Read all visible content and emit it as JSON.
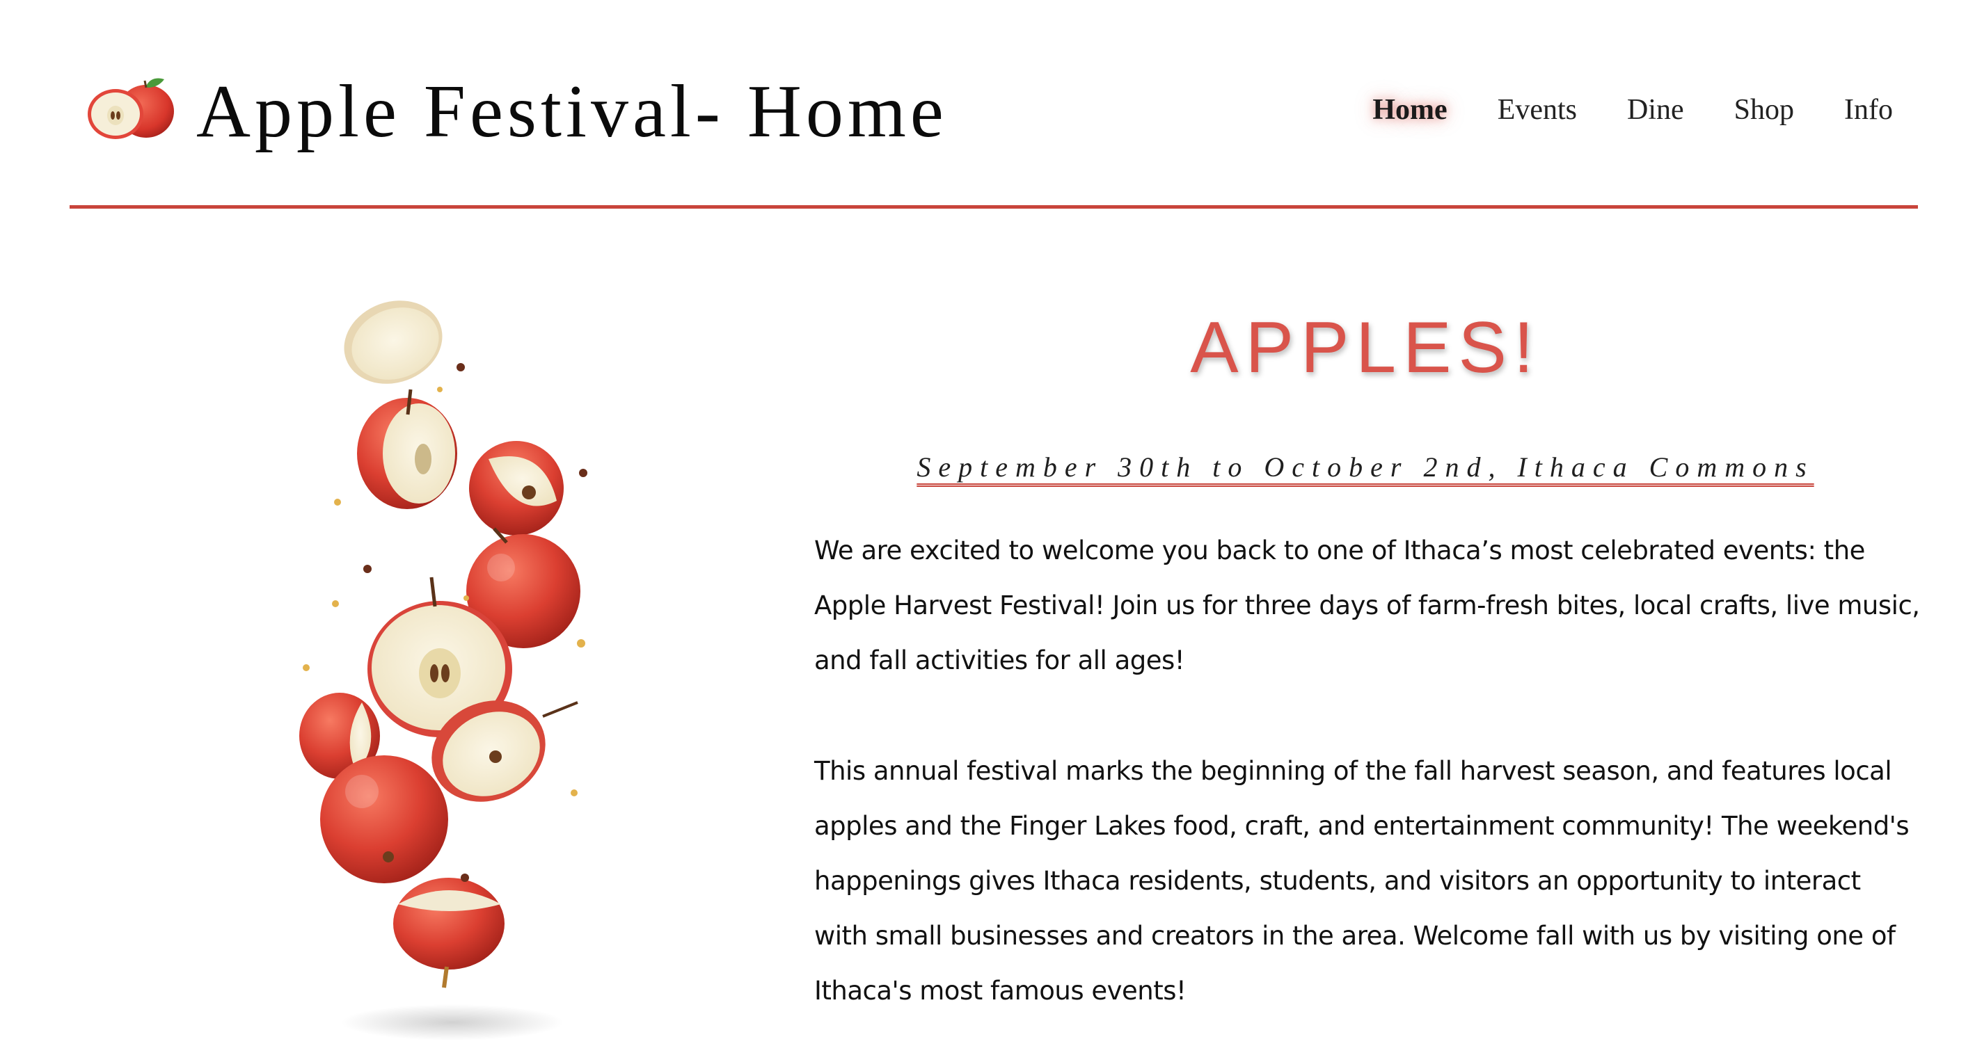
{
  "header": {
    "title": "Apple Festival- Home",
    "logo_icon": "apple-icon",
    "nav": [
      {
        "label": "Home",
        "active": true
      },
      {
        "label": "Events",
        "active": false
      },
      {
        "label": "Dine",
        "active": false
      },
      {
        "label": "Shop",
        "active": false
      },
      {
        "label": "Info",
        "active": false
      }
    ]
  },
  "main": {
    "heading": "APPLES!",
    "dates": "September 30th to October 2nd, Ithaca Commons",
    "paragraphs": [
      "We are excited to welcome you back to one of Ithaca’s most celebrated events: the Apple Harvest Festival! Join us for three days of farm-fresh bites, local crafts, live music, and fall activities for all ages!",
      "This annual festival marks the beginning of the fall harvest season, and features local apples and the Finger Lakes food, craft, and entertainment community! The weekend's happenings gives Ithaca residents, students, and visitors an opportunity to interact with small businesses and creators in the area. Welcome fall with us by visiting one of Ithaca's most famous events!"
    ]
  },
  "colors": {
    "accent": "#c8443b",
    "heading": "#d9544b",
    "apple_red": "#d63a2f",
    "apple_flesh": "#f4ecd8"
  }
}
